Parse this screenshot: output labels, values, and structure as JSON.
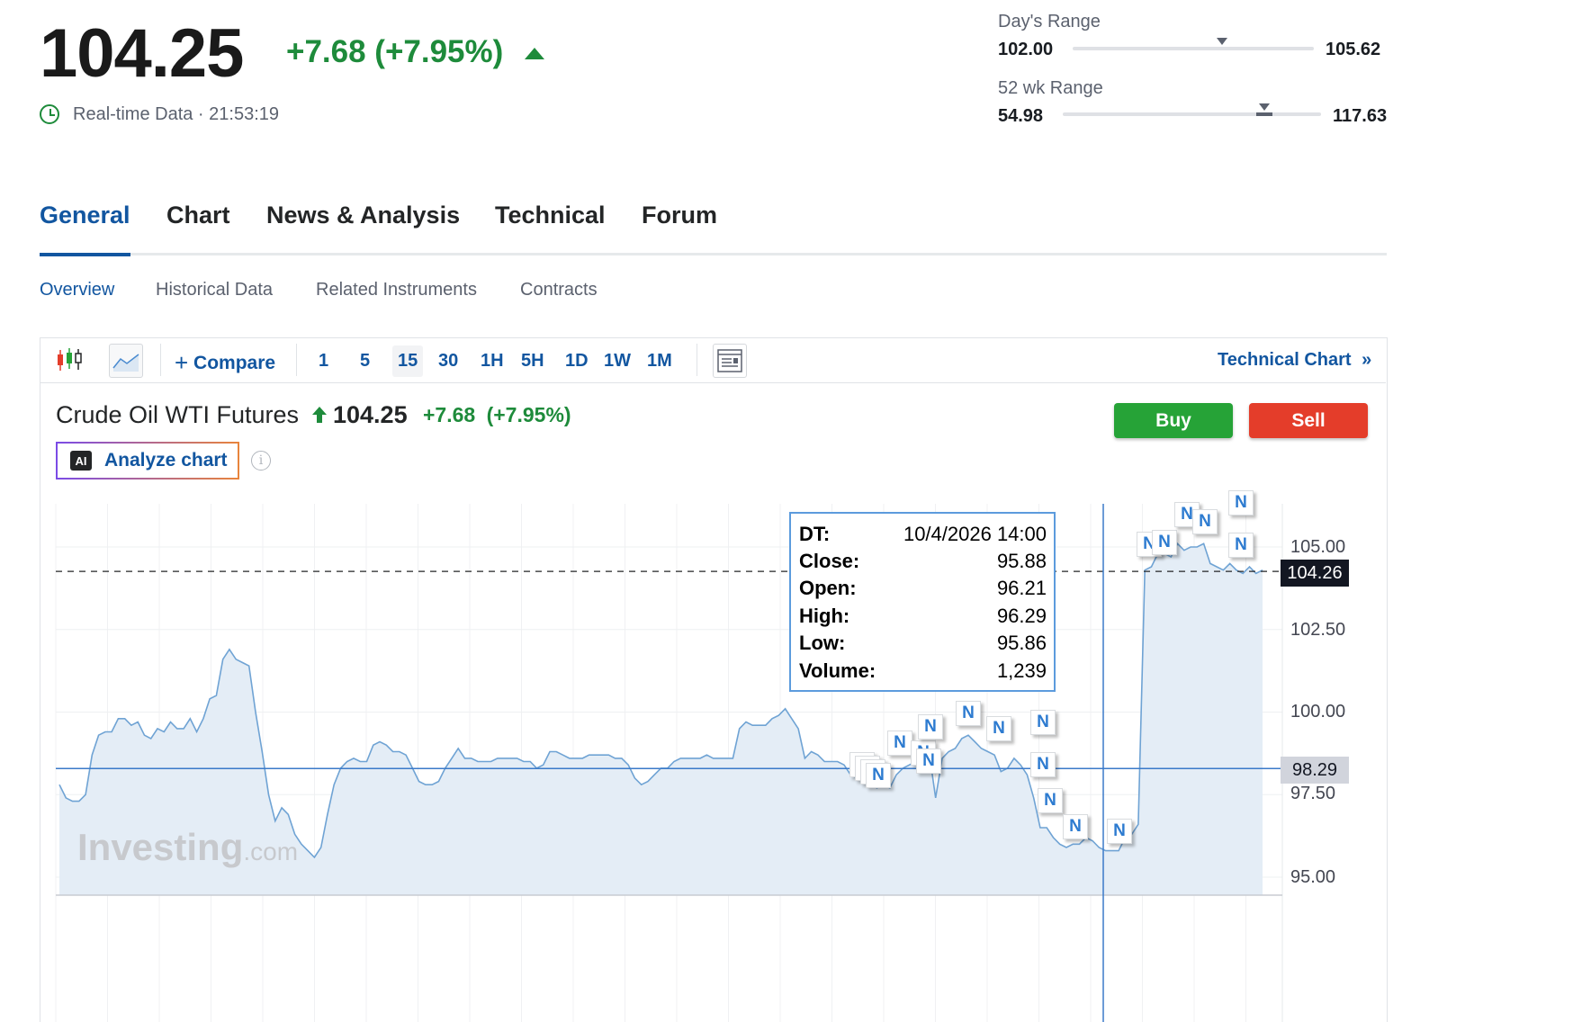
{
  "quote": {
    "price": "104.25",
    "change": "+7.68",
    "change_pct": "(+7.95%)",
    "realtime": "Real-time Data · 21:53:19",
    "days_range_label": "Day's Range",
    "days_low": "102.00",
    "days_high": "105.62",
    "wk52_label": "52 wk Range",
    "wk52_low": "54.98",
    "wk52_high": "117.63"
  },
  "tabs": [
    "General",
    "Chart",
    "News & Analysis",
    "Technical",
    "Forum"
  ],
  "subtabs": [
    "Overview",
    "Historical Data",
    "Related Instruments",
    "Contracts"
  ],
  "toolbar": {
    "compare": "Compare",
    "intervals": [
      "1",
      "5",
      "15",
      "30",
      "1H",
      "5H",
      "1D",
      "1W",
      "1M"
    ],
    "active_interval": "15",
    "technical_chart": "Technical Chart",
    "tech_arrow": "»"
  },
  "instrument": {
    "name": "Crude Oil WTI Futures",
    "price": "104.25",
    "change": "+7.68",
    "change_pct": "(+7.95%)",
    "buy": "Buy",
    "sell": "Sell",
    "analyze_badge": "AI",
    "analyze": "Analyze chart",
    "info": "i"
  },
  "tooltip": {
    "rows": [
      {
        "k": "DT:",
        "v": "10/4/2026 14:00"
      },
      {
        "k": "Close:",
        "v": "95.88"
      },
      {
        "k": "Open:",
        "v": "96.21"
      },
      {
        "k": "High:",
        "v": "96.29"
      },
      {
        "k": "Low:",
        "v": "95.86"
      },
      {
        "k": "Volume:",
        "v": "1,239"
      }
    ]
  },
  "axis": {
    "current": "104.26",
    "crosshair": "98.29"
  },
  "watermark": {
    "main": "Investing",
    "suffix": ".com"
  },
  "news_flag": "N",
  "colors": {
    "up": "#1e8b3b",
    "link": "#1256a0",
    "line": "#6fa3d4",
    "area": "#e3ecf6",
    "buy": "#26a337",
    "sell": "#e43d2a"
  },
  "chart_data": {
    "type": "area",
    "y_ticks": [
      "105.00",
      "102.50",
      "100.00",
      "97.50",
      "95.00"
    ],
    "ylim": [
      94.6,
      106.2
    ],
    "values": [
      97.8,
      97.4,
      97.3,
      97.3,
      97.5,
      98.7,
      99.3,
      99.4,
      99.4,
      99.8,
      99.8,
      99.6,
      99.7,
      99.3,
      99.2,
      99.5,
      99.4,
      99.7,
      99.5,
      99.5,
      99.8,
      99.4,
      99.8,
      100.4,
      100.5,
      101.6,
      101.9,
      101.6,
      101.5,
      101.4,
      100.0,
      98.8,
      97.5,
      96.7,
      97.1,
      96.9,
      96.3,
      96.0,
      95.8,
      95.6,
      95.9,
      96.9,
      97.8,
      98.3,
      98.5,
      98.6,
      98.5,
      98.5,
      99.0,
      99.1,
      99.0,
      98.8,
      98.8,
      98.7,
      98.3,
      97.9,
      97.8,
      97.8,
      97.9,
      98.3,
      98.6,
      98.9,
      98.6,
      98.6,
      98.5,
      98.5,
      98.5,
      98.6,
      98.6,
      98.6,
      98.6,
      98.5,
      98.5,
      98.3,
      98.4,
      98.8,
      98.8,
      98.7,
      98.6,
      98.6,
      98.6,
      98.7,
      98.7,
      98.7,
      98.7,
      98.6,
      98.6,
      98.4,
      98.0,
      97.8,
      97.9,
      98.1,
      98.3,
      98.3,
      98.5,
      98.6,
      98.6,
      98.6,
      98.6,
      98.7,
      98.6,
      98.6,
      98.6,
      98.6,
      99.5,
      99.7,
      99.6,
      99.6,
      99.6,
      99.8,
      99.9,
      100.1,
      99.8,
      99.5,
      98.6,
      98.8,
      98.7,
      98.5,
      98.5,
      98.5,
      98.4,
      98.1,
      98.0,
      98.0,
      97.9,
      97.7,
      97.8,
      97.7,
      98.1,
      98.3,
      98.4,
      98.5,
      98.3,
      98.8,
      97.4,
      98.6,
      98.8,
      98.9,
      99.2,
      99.3,
      99.1,
      98.9,
      98.8,
      98.7,
      98.2,
      98.3,
      98.6,
      98.4,
      98.1,
      97.4,
      96.5,
      96.5,
      96.2,
      96.0,
      95.9,
      96.0,
      96.0,
      96.2,
      96.1,
      95.9,
      95.8,
      95.8,
      95.8,
      96.2,
      96.3,
      96.6,
      104.3,
      104.4,
      104.8,
      104.8,
      104.7,
      105.1,
      104.9,
      105.0,
      105.0,
      105.1,
      104.5,
      104.4,
      104.3,
      104.5,
      104.3,
      104.2,
      104.4,
      104.2,
      104.3
    ],
    "current_value": 104.26,
    "crosshair_value": 98.29
  }
}
